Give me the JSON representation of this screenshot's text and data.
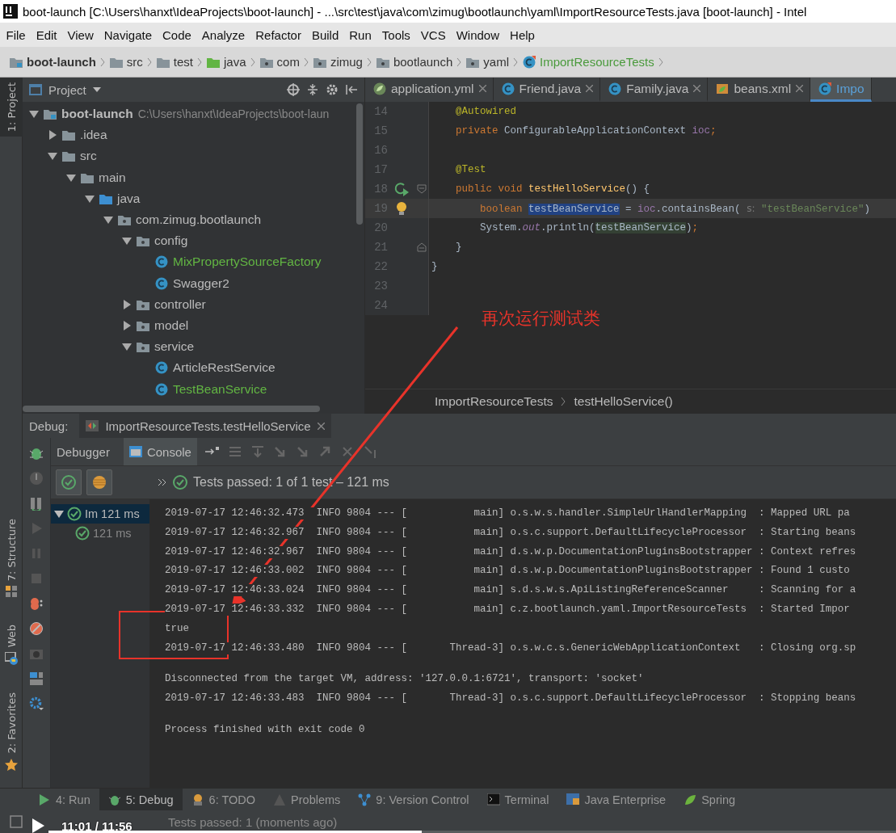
{
  "window": {
    "title": "boot-launch [C:\\Users\\hanxt\\IdeaProjects\\boot-launch] - ...\\src\\test\\java\\com\\zimug\\bootlaunch\\yaml\\ImportResourceTests.java [boot-launch] - Intel"
  },
  "menu": [
    "File",
    "Edit",
    "View",
    "Navigate",
    "Code",
    "Analyze",
    "Refactor",
    "Build",
    "Run",
    "Tools",
    "VCS",
    "Window",
    "Help"
  ],
  "breadcrumb": [
    {
      "label": "boot-launch",
      "kind": "module"
    },
    {
      "label": "src",
      "kind": "folder"
    },
    {
      "label": "test",
      "kind": "folder"
    },
    {
      "label": "java",
      "kind": "test"
    },
    {
      "label": "com",
      "kind": "package"
    },
    {
      "label": "zimug",
      "kind": "package"
    },
    {
      "label": "bootlaunch",
      "kind": "package"
    },
    {
      "label": "yaml",
      "kind": "package"
    },
    {
      "label": "ImportResourceTests",
      "kind": "testclass"
    }
  ],
  "side_tools_top": [
    {
      "label": "1: Project",
      "selected": true
    }
  ],
  "side_tools_bottom": [
    {
      "label": "7: Structure",
      "kind": "structure",
      "selected": false
    },
    {
      "label": "Web",
      "kind": "web",
      "selected": false
    },
    {
      "label": "2: Favorites",
      "kind": "favorites",
      "selected": false
    }
  ],
  "project": {
    "title": "Project",
    "tree": [
      {
        "label": "boot-launch",
        "path": "C:\\Users\\hanxt\\IdeaProjects\\boot-laun",
        "kind": "module",
        "expanded": true,
        "children": [
          {
            "label": ".idea",
            "kind": "folder",
            "expanded": false
          },
          {
            "label": "src",
            "kind": "folder",
            "expanded": true,
            "children": [
              {
                "label": "main",
                "kind": "folder",
                "expanded": true,
                "children": [
                  {
                    "label": "java",
                    "kind": "source",
                    "expanded": true,
                    "children": [
                      {
                        "label": "com.zimug.bootlaunch",
                        "kind": "package",
                        "expanded": true,
                        "children": [
                          {
                            "label": "config",
                            "kind": "package",
                            "expanded": true,
                            "children": [
                              {
                                "label": "MixPropertySourceFactory",
                                "kind": "class",
                                "added": true
                              },
                              {
                                "label": "Swagger2",
                                "kind": "class",
                                "added": false
                              }
                            ]
                          },
                          {
                            "label": "controller",
                            "kind": "package",
                            "expanded": false
                          },
                          {
                            "label": "model",
                            "kind": "package",
                            "expanded": false
                          },
                          {
                            "label": "service",
                            "kind": "package",
                            "expanded": true,
                            "children": [
                              {
                                "label": "ArticleRestService",
                                "kind": "class",
                                "added": false
                              },
                              {
                                "label": "TestBeanService",
                                "kind": "class",
                                "added": true
                              }
                            ]
                          }
                        ]
                      }
                    ]
                  }
                ]
              }
            ]
          }
        ]
      }
    ]
  },
  "editor": {
    "tabs": [
      {
        "label": "application.yml",
        "kind": "yaml",
        "selected": false
      },
      {
        "label": "Friend.java",
        "kind": "class",
        "selected": false
      },
      {
        "label": "Family.java",
        "kind": "class",
        "selected": false
      },
      {
        "label": "beans.xml",
        "kind": "xml",
        "selected": false
      },
      {
        "label": "Impo",
        "kind": "testclass",
        "selected": true
      }
    ],
    "lines": [
      {
        "number": "14",
        "kind": "plain",
        "current": false,
        "tokens": [
          {
            "kind": "annotation",
            "text": "    @Autowired"
          }
        ]
      },
      {
        "number": "15",
        "kind": "plain",
        "current": false,
        "tokens": [
          {
            "kind": "keyword",
            "text": "    private "
          },
          {
            "kind": "plain",
            "text": "ConfigurableApplicationContext "
          },
          {
            "kind": "field",
            "text": "ioc"
          },
          {
            "kind": "keyword",
            "text": ";"
          }
        ]
      },
      {
        "number": "16",
        "kind": "plain",
        "current": false
      },
      {
        "number": "17",
        "kind": "plain",
        "current": false,
        "tokens": [
          {
            "kind": "annotation",
            "text": "    @Test"
          }
        ]
      },
      {
        "number": "18",
        "kind": "run",
        "current": false,
        "tokens": [
          {
            "kind": "keyword",
            "text": "    public void "
          },
          {
            "kind": "method",
            "text": "testHelloService"
          },
          {
            "kind": "plain",
            "text": "() {"
          }
        ]
      },
      {
        "number": "19",
        "kind": "bulb",
        "current": true,
        "tokens": [
          {
            "kind": "keyword",
            "text": "        boolean "
          },
          {
            "kind": "selection",
            "text": "testBeanService"
          },
          {
            "kind": "plain",
            "text": " = "
          },
          {
            "kind": "field",
            "text": "ioc"
          },
          {
            "kind": "plain",
            "text": ".containsBean( "
          },
          {
            "kind": "hint",
            "text": "s:"
          },
          {
            "kind": "string",
            "text": " \"testBeanService\""
          },
          {
            "kind": "plain",
            "text": ")"
          }
        ]
      },
      {
        "number": "20",
        "kind": "plain",
        "current": false,
        "tokens": [
          {
            "kind": "plain",
            "text": "        System."
          },
          {
            "kind": "static",
            "text": "out"
          },
          {
            "kind": "plain",
            "text": ".println("
          },
          {
            "kind": "usage",
            "text": "testBeanService"
          },
          {
            "kind": "plain",
            "text": ")"
          },
          {
            "kind": "keyword",
            "text": ";"
          }
        ]
      },
      {
        "number": "21",
        "kind": "fold-end",
        "current": false,
        "tokens": [
          {
            "kind": "plain",
            "text": "    }"
          }
        ]
      },
      {
        "number": "22",
        "kind": "plain",
        "current": false,
        "tokens": [
          {
            "kind": "plain",
            "text": "}"
          }
        ]
      },
      {
        "number": "23",
        "kind": "plain",
        "current": false
      },
      {
        "number": "24",
        "kind": "plain",
        "current": false
      }
    ],
    "breadcrumb": [
      "ImportResourceTests",
      "testHelloService()"
    ]
  },
  "annotation": {
    "text": "再次运行测试类"
  },
  "debug": {
    "label": "Debug:",
    "session": "ImportResourceTests.testHelloService",
    "tabs": [
      {
        "label": "Debugger",
        "selected": false
      },
      {
        "label": "Console",
        "selected": true
      }
    ],
    "status": "Tests passed: 1 of 1 test – 121 ms",
    "tests": [
      {
        "name": "Im",
        "time": "121 ms",
        "expanded": true,
        "selected": true,
        "children": [
          {
            "time": "121 ms",
            "selected": false
          }
        ]
      }
    ],
    "console": {
      "blocks": [
        [
          "2019-07-17 12:46:32.473  INFO 9804 --- [           main] o.s.w.s.handler.SimpleUrlHandlerMapping  : Mapped URL pa",
          "2019-07-17 12:46:32.967  INFO 9804 --- [           main] o.s.c.support.DefaultLifecycleProcessor  : Starting beans",
          "2019-07-17 12:46:32.967  INFO 9804 --- [           main] d.s.w.p.DocumentationPluginsBootstrapper : Context refres",
          "2019-07-17 12:46:33.002  INFO 9804 --- [           main] d.s.w.p.DocumentationPluginsBootstrapper : Found 1 custo",
          "2019-07-17 12:46:33.024  INFO 9804 --- [           main] s.d.s.w.s.ApiListingReferenceScanner     : Scanning for a",
          "2019-07-17 12:46:33.332  INFO 9804 --- [           main] c.z.bootlaunch.yaml.ImportResourceTests  : Started Impor",
          "true",
          "2019-07-17 12:46:33.480  INFO 9804 --- [       Thread-3] o.s.w.c.s.GenericWebApplicationContext   : Closing org.sp"
        ],
        [
          "Disconnected from the target VM, address: '127.0.0.1:6721', transport: 'socket'",
          "2019-07-17 12:46:33.483  INFO 9804 --- [       Thread-3] o.s.c.support.DefaultLifecycleProcessor  : Stopping beans"
        ],
        [
          "Process finished with exit code 0"
        ]
      ]
    }
  },
  "tool_windows": [
    {
      "label": "4: Run",
      "kind": "run",
      "selected": false
    },
    {
      "label": "5: Debug",
      "kind": "debug",
      "selected": true
    },
    {
      "label": "6: TODO",
      "kind": "todo",
      "selected": false
    },
    {
      "label": "Problems",
      "kind": "problems",
      "selected": false
    },
    {
      "label": "9: Version Control",
      "kind": "vcs",
      "selected": false
    },
    {
      "label": "Terminal",
      "kind": "terminal",
      "selected": false
    },
    {
      "label": "Java Enterprise",
      "kind": "javaee",
      "selected": false
    },
    {
      "label": "Spring",
      "kind": "spring",
      "selected": false
    }
  ],
  "status_bar": {
    "text": "Tests passed: 1 (moments ago)"
  },
  "video": {
    "time": "11:01 / 11:56",
    "level": 0.44
  }
}
